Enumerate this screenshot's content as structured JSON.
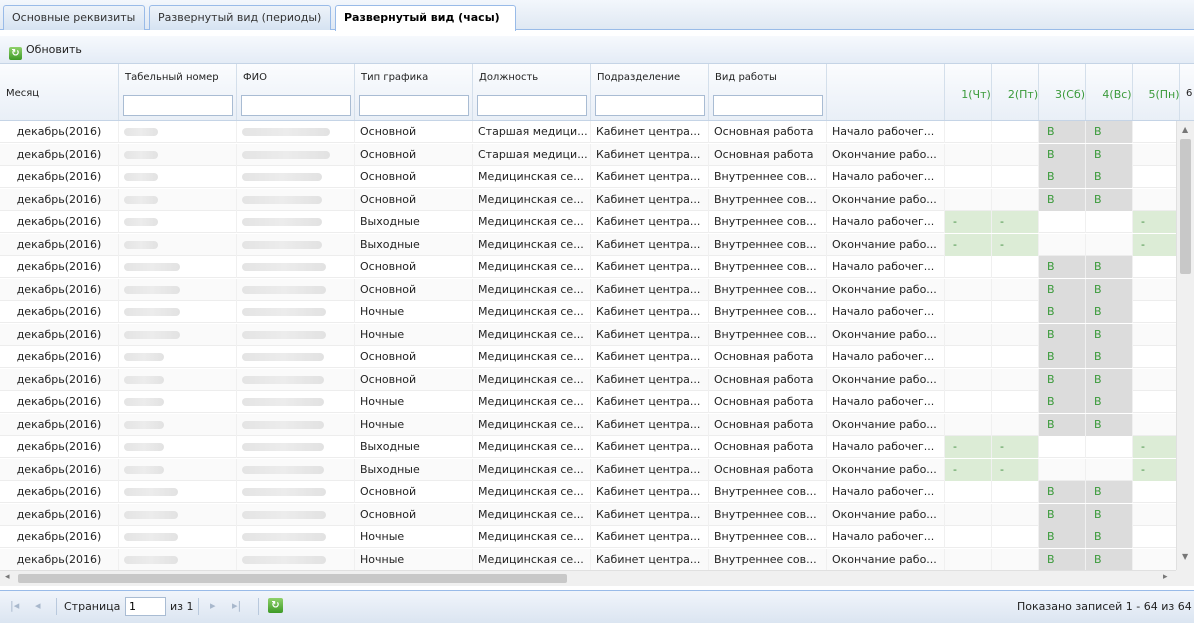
{
  "tabs": [
    {
      "label": "Основные реквизиты",
      "active": false
    },
    {
      "label": "Развернутый вид (периоды)",
      "active": false
    },
    {
      "label": "Развернутый вид (часы)",
      "active": true
    }
  ],
  "toolbar": {
    "refresh_label": "Обновить",
    "refresh_icon": "refresh-icon"
  },
  "columns": {
    "month": "Месяц",
    "tabnum": "Табельный номер",
    "fio": "ФИО",
    "schedule": "Тип графика",
    "position": "Должность",
    "division": "Подразделение",
    "worktype": "Вид работы",
    "interval": ""
  },
  "days": [
    "1(Чт)",
    "2(Пт)",
    "3(Сб)",
    "4(Вс)",
    "5(Пн)",
    "6"
  ],
  "rows": [
    {
      "month": "декабрь(2016)",
      "schedule": "Основной",
      "position": "Старшая медици...",
      "division": "Кабинет центра...",
      "worktype": "Основная работа",
      "interval": "Начало рабочег...",
      "days": [
        "",
        "",
        "В",
        "В",
        ""
      ]
    },
    {
      "month": "декабрь(2016)",
      "schedule": "Основной",
      "position": "Старшая медици...",
      "division": "Кабинет центра...",
      "worktype": "Основная работа",
      "interval": "Окончание рабо...",
      "days": [
        "",
        "",
        "В",
        "В",
        ""
      ]
    },
    {
      "month": "декабрь(2016)",
      "schedule": "Основной",
      "position": "Медицинская се...",
      "division": "Кабинет центра...",
      "worktype": "Внутреннее сов...",
      "interval": "Начало рабочег...",
      "days": [
        "",
        "",
        "В",
        "В",
        ""
      ]
    },
    {
      "month": "декабрь(2016)",
      "schedule": "Основной",
      "position": "Медицинская се...",
      "division": "Кабинет центра...",
      "worktype": "Внутреннее сов...",
      "interval": "Окончание рабо...",
      "days": [
        "",
        "",
        "В",
        "В",
        ""
      ]
    },
    {
      "month": "декабрь(2016)",
      "schedule": "Выходные",
      "position": "Медицинская се...",
      "division": "Кабинет центра...",
      "worktype": "Внутреннее сов...",
      "interval": "Начало рабочег...",
      "days": [
        "-",
        "-",
        "",
        "",
        "-"
      ]
    },
    {
      "month": "декабрь(2016)",
      "schedule": "Выходные",
      "position": "Медицинская се...",
      "division": "Кабинет центра...",
      "worktype": "Внутреннее сов...",
      "interval": "Окончание рабо...",
      "days": [
        "-",
        "-",
        "",
        "",
        "-"
      ]
    },
    {
      "month": "декабрь(2016)",
      "schedule": "Основной",
      "position": "Медицинская се...",
      "division": "Кабинет центра...",
      "worktype": "Внутреннее сов...",
      "interval": "Начало рабочег...",
      "days": [
        "",
        "",
        "В",
        "В",
        ""
      ]
    },
    {
      "month": "декабрь(2016)",
      "schedule": "Основной",
      "position": "Медицинская се...",
      "division": "Кабинет центра...",
      "worktype": "Внутреннее сов...",
      "interval": "Окончание рабо...",
      "days": [
        "",
        "",
        "В",
        "В",
        ""
      ]
    },
    {
      "month": "декабрь(2016)",
      "schedule": "Ночные",
      "position": "Медицинская се...",
      "division": "Кабинет центра...",
      "worktype": "Внутреннее сов...",
      "interval": "Начало рабочег...",
      "days": [
        "",
        "",
        "В",
        "В",
        ""
      ]
    },
    {
      "month": "декабрь(2016)",
      "schedule": "Ночные",
      "position": "Медицинская се...",
      "division": "Кабинет центра...",
      "worktype": "Внутреннее сов...",
      "interval": "Окончание рабо...",
      "days": [
        "",
        "",
        "В",
        "В",
        ""
      ]
    },
    {
      "month": "декабрь(2016)",
      "schedule": "Основной",
      "position": "Медицинская се...",
      "division": "Кабинет центра...",
      "worktype": "Основная работа",
      "interval": "Начало рабочег...",
      "days": [
        "",
        "",
        "В",
        "В",
        ""
      ]
    },
    {
      "month": "декабрь(2016)",
      "schedule": "Основной",
      "position": "Медицинская се...",
      "division": "Кабинет центра...",
      "worktype": "Основная работа",
      "interval": "Окончание рабо...",
      "days": [
        "",
        "",
        "В",
        "В",
        ""
      ]
    },
    {
      "month": "декабрь(2016)",
      "schedule": "Ночные",
      "position": "Медицинская се...",
      "division": "Кабинет центра...",
      "worktype": "Основная работа",
      "interval": "Начало рабочег...",
      "days": [
        "",
        "",
        "В",
        "В",
        ""
      ]
    },
    {
      "month": "декабрь(2016)",
      "schedule": "Ночные",
      "position": "Медицинская се...",
      "division": "Кабинет центра...",
      "worktype": "Основная работа",
      "interval": "Окончание рабо...",
      "days": [
        "",
        "",
        "В",
        "В",
        ""
      ]
    },
    {
      "month": "декабрь(2016)",
      "schedule": "Выходные",
      "position": "Медицинская се...",
      "division": "Кабинет центра...",
      "worktype": "Основная работа",
      "interval": "Начало рабочег...",
      "days": [
        "-",
        "-",
        "",
        "",
        "-"
      ]
    },
    {
      "month": "декабрь(2016)",
      "schedule": "Выходные",
      "position": "Медицинская се...",
      "division": "Кабинет центра...",
      "worktype": "Основная работа",
      "interval": "Окончание рабо...",
      "days": [
        "-",
        "-",
        "",
        "",
        "-"
      ]
    },
    {
      "month": "декабрь(2016)",
      "schedule": "Основной",
      "position": "Медицинская се...",
      "division": "Кабинет центра...",
      "worktype": "Внутреннее сов...",
      "interval": "Начало рабочег...",
      "days": [
        "",
        "",
        "В",
        "В",
        ""
      ]
    },
    {
      "month": "декабрь(2016)",
      "schedule": "Основной",
      "position": "Медицинская се...",
      "division": "Кабинет центра...",
      "worktype": "Внутреннее сов...",
      "interval": "Окончание рабо...",
      "days": [
        "",
        "",
        "В",
        "В",
        ""
      ]
    },
    {
      "month": "декабрь(2016)",
      "schedule": "Ночные",
      "position": "Медицинская се...",
      "division": "Кабинет центра...",
      "worktype": "Внутреннее сов...",
      "interval": "Начало рабочег...",
      "days": [
        "",
        "",
        "В",
        "В",
        ""
      ]
    },
    {
      "month": "декабрь(2016)",
      "schedule": "Ночные",
      "position": "Медицинская се...",
      "division": "Кабинет центра...",
      "worktype": "Внутреннее сов...",
      "interval": "Окончание рабо...",
      "days": [
        "",
        "",
        "В",
        "В",
        ""
      ]
    }
  ],
  "pager": {
    "page_label": "Страница",
    "page_value": "1",
    "of_label": "из 1",
    "summary": "Показано записей 1 - 64 из 64"
  },
  "colors": {
    "accent_border": "#99bbe8",
    "weekend_text": "#3a9a3a",
    "weekend_bg": "#dcdcdc"
  }
}
